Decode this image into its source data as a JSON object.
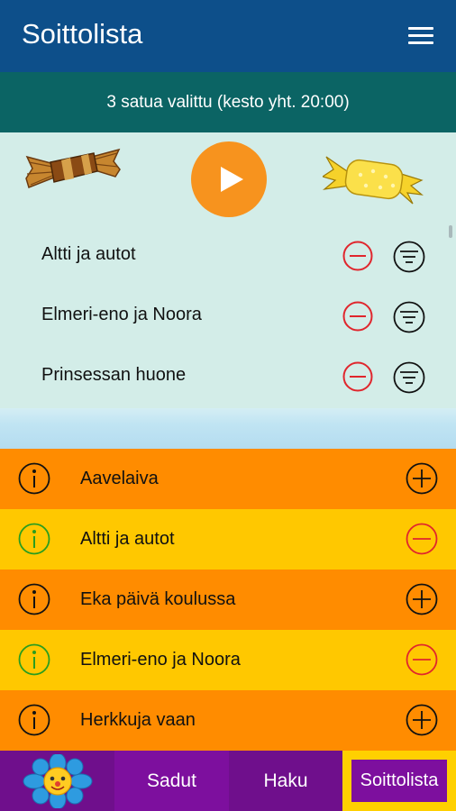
{
  "header": {
    "title": "Soittolista",
    "menu_icon": "hamburger-icon"
  },
  "summary": {
    "text": "3 satua valittu (kesto yht. 20:00)"
  },
  "player": {
    "play_icon": "play-icon",
    "left_candy": "candy-brown",
    "right_candy": "candy-yellow"
  },
  "playlist": [
    {
      "title": "Altti ja autot"
    },
    {
      "title": "Elmeri-eno ja Noora"
    },
    {
      "title": "Prinsessan huone"
    }
  ],
  "library": [
    {
      "title": "Aavelaiva",
      "selected": false
    },
    {
      "title": "Altti ja autot",
      "selected": true
    },
    {
      "title": "Eka päivä koulussa",
      "selected": false
    },
    {
      "title": "Elmeri-eno ja Noora",
      "selected": true
    },
    {
      "title": "Herkkuja vaan",
      "selected": false
    }
  ],
  "tabs": {
    "home_icon": "flower-icon",
    "sadut": "Sadut",
    "haku": "Haku",
    "soittolista": "Soittolista"
  },
  "colors": {
    "header": "#0d4f8a",
    "subheader": "#0b6464",
    "playlist_bg": "#d3ede8",
    "play": "#f7931e",
    "row_orange": "#ff8c00",
    "row_yellow": "#ffc800",
    "remove_red": "#e0262d",
    "info_green": "#2a9d1f",
    "tab_purple": "#6f0f8c",
    "tab_active": "#ffd000"
  }
}
